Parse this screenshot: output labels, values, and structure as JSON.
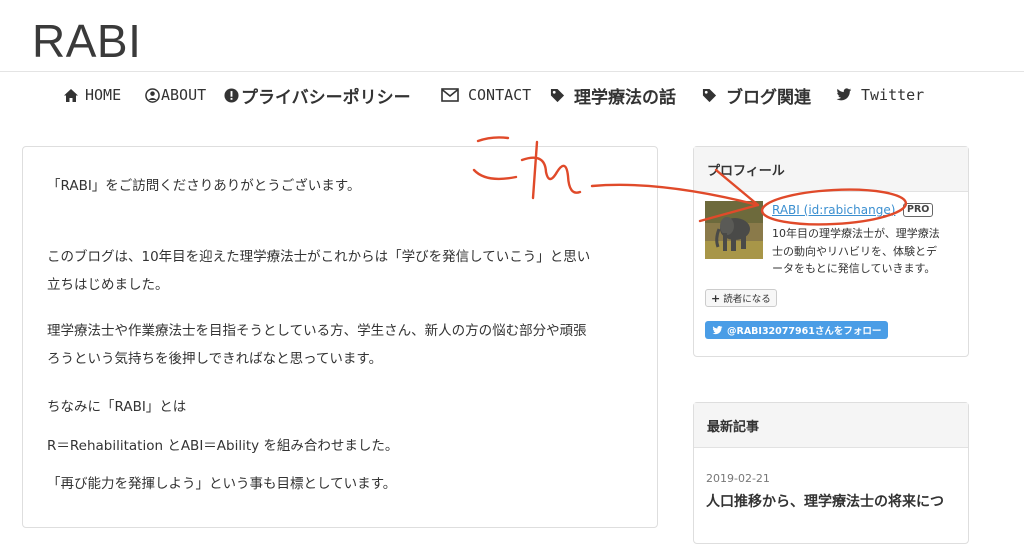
{
  "site": {
    "title": "RABI"
  },
  "nav": {
    "items": [
      {
        "label": "HOME",
        "icon": "home-icon"
      },
      {
        "label": "ABOUT",
        "icon": "user-circle-icon"
      },
      {
        "label": "プライバシーポリシー",
        "icon": "exclamation-circle-icon"
      },
      {
        "label": "CONTACT",
        "icon": "envelope-icon"
      },
      {
        "label": "理学療法の話",
        "icon": "tag-icon"
      },
      {
        "label": "ブログ関連",
        "icon": "tag-icon"
      },
      {
        "label": "Twitter",
        "icon": "twitter-icon"
      }
    ]
  },
  "article": {
    "paragraphs": [
      "「RABI」をご訪問くださりありがとうございます。",
      "このブログは、10年目を迎えた理学療法士がこれからは「学びを発信していこう」と思い",
      "立ちはじめました。",
      "理学療法士や作業療法士を目指そうとしている方、学生さん、新人の方の悩む部分や頑張",
      "ろうという気持ちを後押しできればなと思っています。",
      "ちなみに「RABI」とは",
      "R＝Rehabilitation とABI＝Ability を組み合わせました。",
      "「再び能力を発揮しよう」という事も目標としています。"
    ]
  },
  "profile": {
    "heading": "プロフィール",
    "name": "RABI (id:rabichange)",
    "badge": "PRO",
    "description": [
      "10年目の理学療法士が、理学療法",
      "士の動向やリハビリを、体験とデ",
      "ータをもとに発信していきます。"
    ],
    "reader_button": "読者になる",
    "follow_button": "@RABI32077961さんをフォロー"
  },
  "recent": {
    "heading": "最新記事",
    "date": "2019-02-21",
    "title": "人口推移から、理学療法士の将来につ"
  },
  "annotation": {
    "text": "これ",
    "color": "#e04a2a"
  },
  "colors": {
    "link": "#3b8fd0",
    "twitter": "#4a9de6",
    "annotation": "#e04a2a"
  }
}
